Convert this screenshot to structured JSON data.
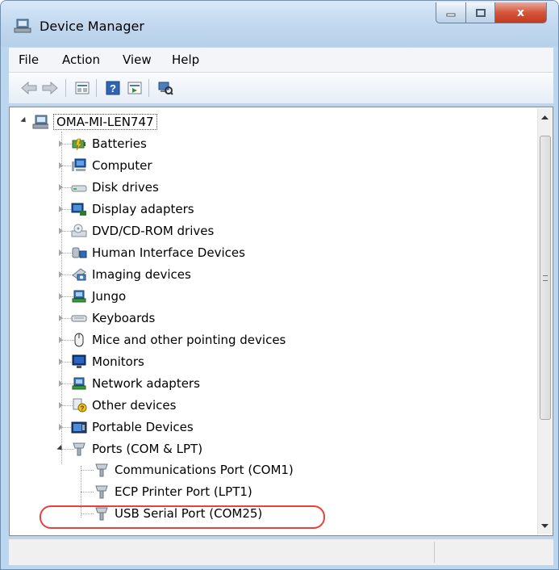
{
  "window": {
    "title": "Device Manager",
    "close_glyph": "x"
  },
  "menu": [
    "File",
    "Action",
    "View",
    "Help"
  ],
  "toolbar": {
    "buttons": [
      "back-arrow-icon",
      "forward-arrow-icon",
      "properties-icon",
      "help-icon",
      "show-hidden-icon",
      "scan-hardware-icon"
    ]
  },
  "tree": {
    "root": "OMA-MI-LEN747",
    "categories": [
      {
        "label": "Batteries",
        "icon": "battery-icon"
      },
      {
        "label": "Computer",
        "icon": "computer-icon"
      },
      {
        "label": "Disk drives",
        "icon": "disk-drive-icon"
      },
      {
        "label": "Display adapters",
        "icon": "display-adapter-icon"
      },
      {
        "label": "DVD/CD-ROM drives",
        "icon": "dvd-drive-icon"
      },
      {
        "label": "Human Interface Devices",
        "icon": "hid-icon"
      },
      {
        "label": "Imaging devices",
        "icon": "camera-icon"
      },
      {
        "label": "Jungo",
        "icon": "network-plug-icon"
      },
      {
        "label": "Keyboards",
        "icon": "keyboard-icon"
      },
      {
        "label": "Mice and other pointing devices",
        "icon": "mouse-icon"
      },
      {
        "label": "Monitors",
        "icon": "monitor-icon"
      },
      {
        "label": "Network adapters",
        "icon": "network-adapter-icon"
      },
      {
        "label": "Other devices",
        "icon": "unknown-device-icon"
      },
      {
        "label": "Portable Devices",
        "icon": "portable-device-icon"
      },
      {
        "label": "Ports (COM & LPT)",
        "icon": "port-icon"
      }
    ],
    "ports_children": [
      {
        "label": "Communications Port (COM1)",
        "icon": "port-icon"
      },
      {
        "label": "ECP Printer Port (LPT1)",
        "icon": "port-icon"
      },
      {
        "label": "USB Serial Port (COM25)",
        "icon": "port-icon"
      }
    ]
  },
  "colors": {
    "highlight": "#e8423a",
    "title_bar": "#bfd6ee"
  }
}
